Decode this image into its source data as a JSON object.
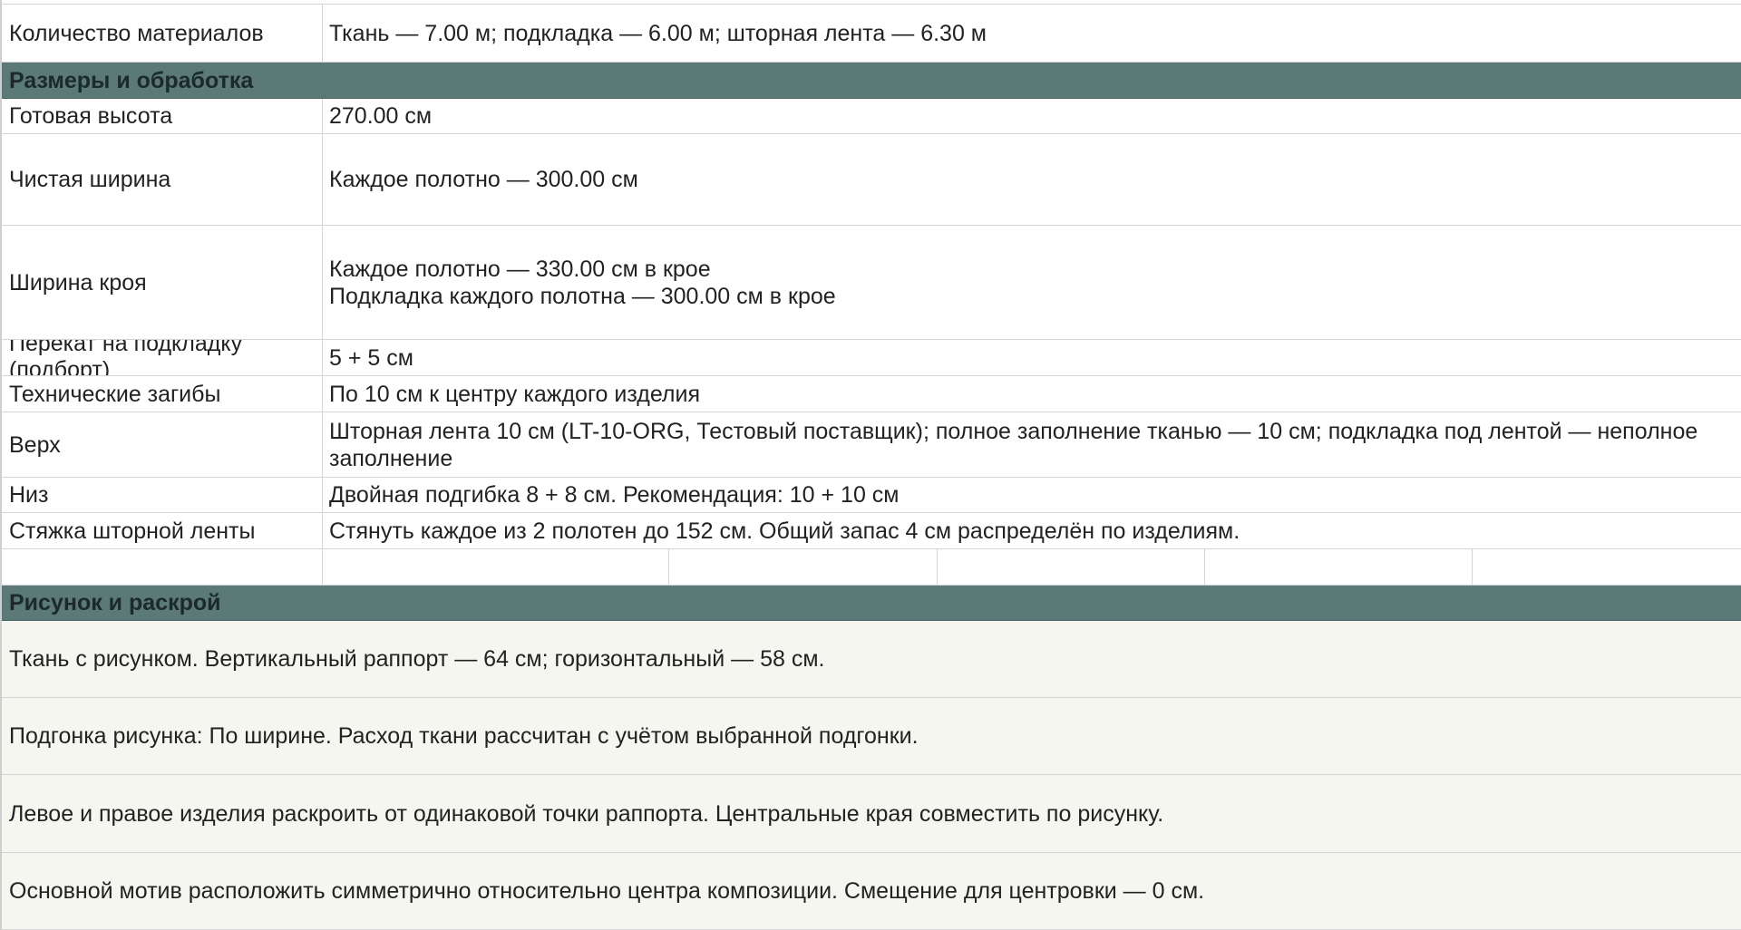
{
  "rows": {
    "materials": {
      "label": "Количество материалов",
      "value": "Ткань — 7.00 м; подкладка — 6.00 м; шторная лента — 6.30 м"
    },
    "section_sizes": "Размеры и обработка",
    "finished_height": {
      "label": "Готовая высота",
      "value": "270.00 см"
    },
    "net_width": {
      "label": "Чистая ширина",
      "value": "Каждое полотно — 300.00 см"
    },
    "cut_width": {
      "label": "Ширина кроя",
      "value": "Каждое полотно — 330.00 см в крое\nПодкладка каждого полотна — 300.00 см в крое"
    },
    "lining_overlap": {
      "label": "Перекат на подкладку\n(подборт)",
      "value": "5 + 5 см"
    },
    "tech_folds": {
      "label": "Технические загибы",
      "value": "По 10 см к центру каждого изделия"
    },
    "top": {
      "label": "Верх",
      "value": "Шторная лента 10 см (LT-10-ORG, Тестовый поставщик); полное заполнение тканью — 10 см; подкладка под лентой — неполное заполнение"
    },
    "bottom": {
      "label": "Низ",
      "value": "Двойная подгибка 8 + 8 см. Рекомендация: 10 + 10 см"
    },
    "tape_gather": {
      "label": "Стяжка шторной ленты",
      "value": "Стянуть каждое из 2 полотен до 152 см. Общий запас 4 см распределён по изделиям."
    },
    "section_pattern": "Рисунок и раскрой",
    "notes": [
      "Ткань с рисунком. Вертикальный раппорт — 64 см; горизонтальный — 58 см.",
      "Подгонка рисунка: По ширине. Расход ткани рассчитан с учётом выбранной подгонки.",
      "Левое и правое изделия раскроить от одинаковой точки раппорта. Центральные края совместить по рисунку.",
      "Основной мотив расположить симметрично относительно центра композиции. Смещение для центровки — 0 см."
    ]
  }
}
